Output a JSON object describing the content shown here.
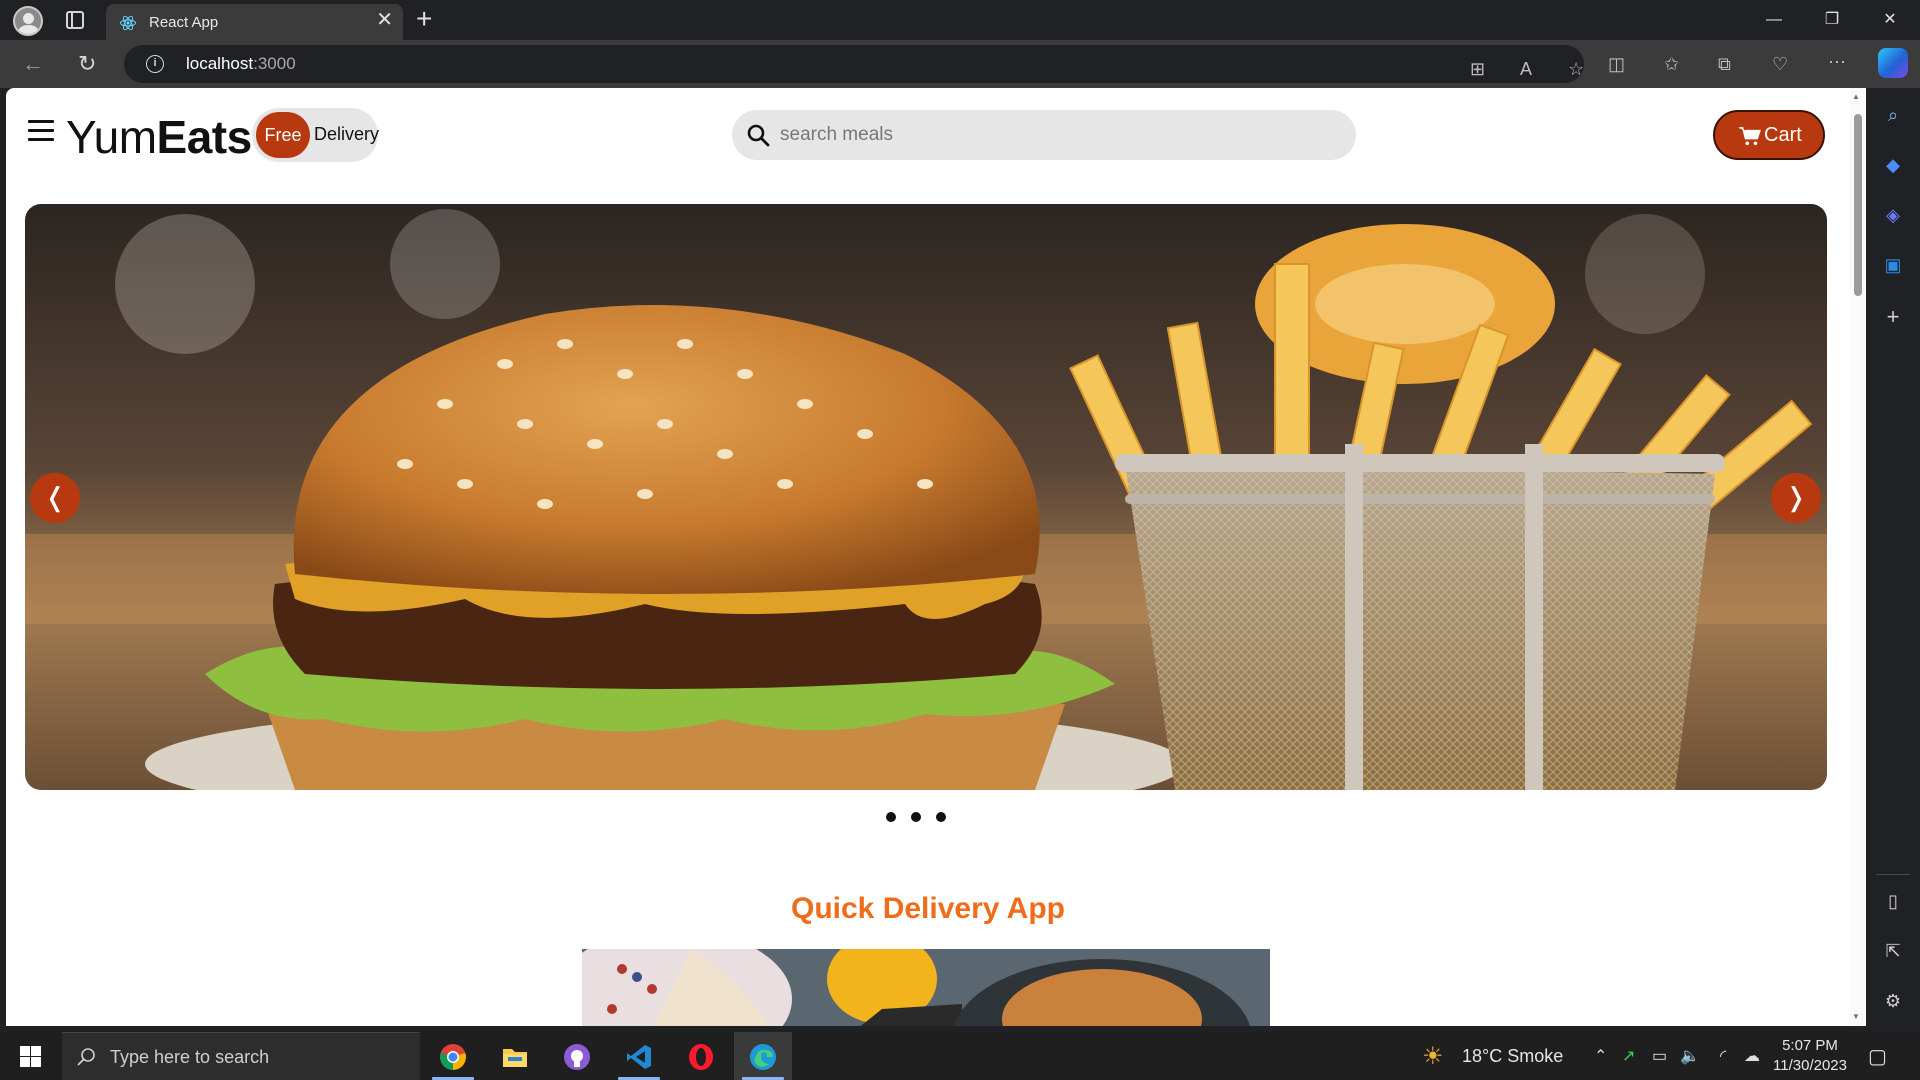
{
  "browser": {
    "tab_title": "React App",
    "url_host": "localhost",
    "url_port": ":3000",
    "tab_close": "✕",
    "new_tab": "+",
    "back": "←",
    "reload": "↻"
  },
  "window_controls": {
    "minimize": "—",
    "maximize": "❐",
    "close": "✕"
  },
  "navbar": {
    "brand_light": "Yum",
    "brand_bold": "Eats",
    "free_badge": "Free",
    "free_label": "Delivery",
    "search_placeholder": "search meals",
    "search_value": "",
    "cart_label": "Cart"
  },
  "carousel": {
    "prev_label": "❬",
    "next_label": "❭",
    "slide_count": 3,
    "image_alt": "Burger with fries in a wire basket"
  },
  "section": {
    "title": "Quick Delivery App"
  },
  "taskbar": {
    "search_placeholder": "Type here to search",
    "apps": [
      "chrome-icon",
      "file-explorer-icon",
      "github-desktop-icon",
      "vscode-icon",
      "opera-icon",
      "edge-icon"
    ],
    "weather": "18°C  Smoke",
    "time": "5:07 PM",
    "date": "11/30/2023"
  },
  "colors": {
    "accent": "#b8390f",
    "title_orange": "#ef6c1a",
    "pill_gray": "#e6e6e6"
  }
}
